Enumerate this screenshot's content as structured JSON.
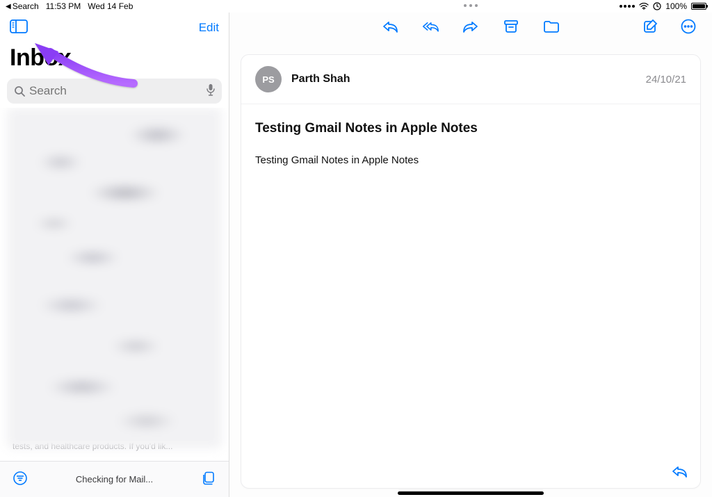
{
  "status_bar": {
    "back_app": "Search",
    "time": "11:53 PM",
    "date": "Wed 14 Feb",
    "battery_pct": "100%"
  },
  "sidebar": {
    "edit_label": "Edit",
    "title": "Inbox",
    "search_placeholder": "Search",
    "peek_text": "tests, and healthcare products. If you'd lik...",
    "status_text": "Checking for Mail..."
  },
  "toolbar": {
    "reply_icon": "reply",
    "reply_all_icon": "reply-all",
    "forward_icon": "forward",
    "archive_icon": "archive",
    "move_icon": "move-folder",
    "compose_icon": "compose",
    "more_icon": "more"
  },
  "message": {
    "avatar_initials": "PS",
    "sender": "Parth Shah",
    "date": "24/10/21",
    "subject": "Testing Gmail Notes in Apple Notes",
    "body": "Testing Gmail Notes in Apple Notes"
  }
}
